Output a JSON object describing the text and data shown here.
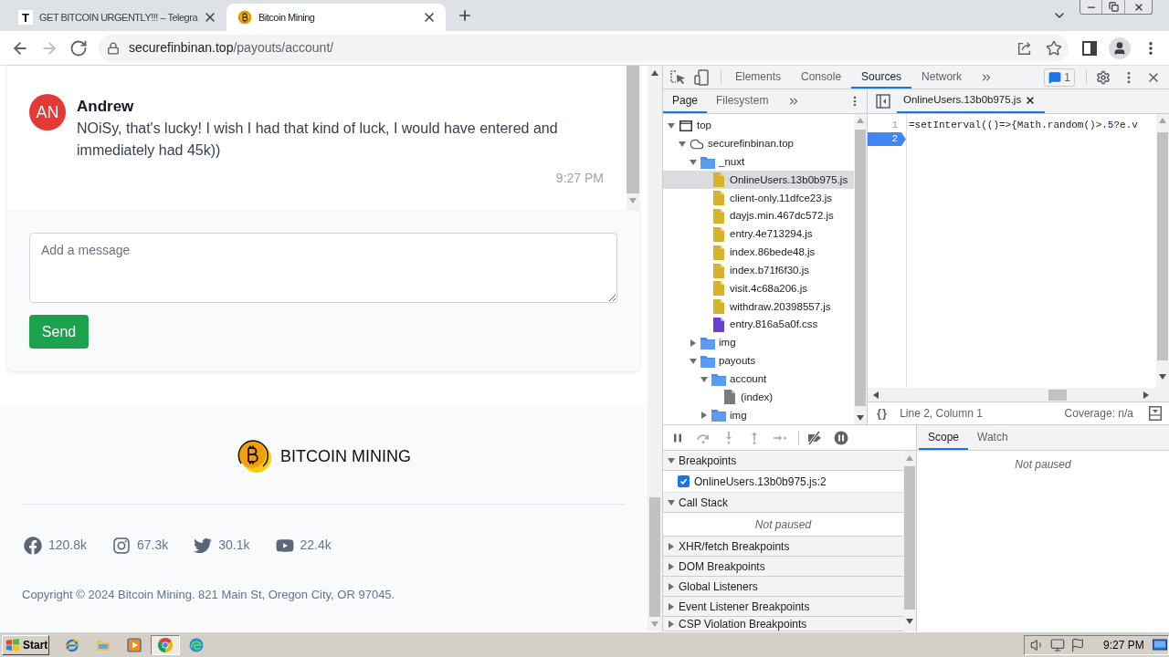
{
  "browser": {
    "tabs": [
      {
        "favicon": "T",
        "title": "GET BITCOIN URGENTLY!!! – Telegra",
        "selected": false
      },
      {
        "title": "Bitcoin Mining",
        "selected": true
      }
    ],
    "address": {
      "host": "securefinbinan.top",
      "path": "/payouts/account/"
    }
  },
  "page": {
    "messages": [
      {
        "initials": "AN",
        "author": "Andrew",
        "text": "NOiSy, that's lucky! I wish I had that kind of luck, I would have entered and immediately had 45k))",
        "time": "9:27 PM"
      }
    ],
    "composer": {
      "placeholder": "Add a message"
    },
    "send_button": "Send",
    "footer": {
      "brand": "BITCOIN MINING",
      "socials": [
        {
          "kind": "facebook",
          "count": "120.8k"
        },
        {
          "kind": "instagram",
          "count": "67.3k"
        },
        {
          "kind": "twitter",
          "count": "30.1k"
        },
        {
          "kind": "youtube",
          "count": "22.4k"
        }
      ],
      "copyright": "Copyright © 2024 Bitcoin Mining. 821 Main St, Oregon City, OR 97045."
    }
  },
  "devtools": {
    "tabs": [
      {
        "label": "Elements",
        "selected": false
      },
      {
        "label": "Console",
        "selected": false
      },
      {
        "label": "Sources",
        "selected": true
      },
      {
        "label": "Network",
        "selected": false
      }
    ],
    "issues_count": "1",
    "navigator": {
      "tabs": [
        {
          "label": "Page",
          "selected": true
        },
        {
          "label": "Filesystem",
          "selected": false
        }
      ],
      "tree": [
        {
          "label": "top",
          "kind": "frame",
          "expanded": true,
          "selected": false,
          "children": [
            {
              "label": "securefinbinan.top",
              "kind": "domain",
              "expanded": true,
              "selected": false,
              "children": [
                {
                  "label": "_nuxt",
                  "kind": "folder",
                  "expanded": true,
                  "selected": false,
                  "children": [
                    {
                      "label": "OnlineUsers.13b0b975.js",
                      "kind": "script",
                      "selected": true
                    },
                    {
                      "label": "client-only.11dfce23.js",
                      "kind": "script",
                      "selected": false
                    },
                    {
                      "label": "dayjs.min.467dc572.js",
                      "kind": "script",
                      "selected": false
                    },
                    {
                      "label": "entry.4e713294.js",
                      "kind": "script",
                      "selected": false
                    },
                    {
                      "label": "index.86bede48.js",
                      "kind": "script",
                      "selected": false
                    },
                    {
                      "label": "index.b71f6f30.js",
                      "kind": "script",
                      "selected": false
                    },
                    {
                      "label": "visit.4c68a206.js",
                      "kind": "script",
                      "selected": false
                    },
                    {
                      "label": "withdraw.20398557.js",
                      "kind": "script",
                      "selected": false
                    },
                    {
                      "label": "entry.816a5a0f.css",
                      "kind": "stylesheet",
                      "selected": false
                    }
                  ]
                },
                {
                  "label": "img",
                  "kind": "folder",
                  "expanded": false,
                  "selected": false
                },
                {
                  "label": "payouts",
                  "kind": "folder",
                  "expanded": true,
                  "selected": false,
                  "children": [
                    {
                      "label": "account",
                      "kind": "folder",
                      "expanded": true,
                      "selected": false,
                      "children": [
                        {
                          "label": "(index)",
                          "kind": "document",
                          "selected": false
                        }
                      ]
                    },
                    {
                      "label": "img",
                      "kind": "folder",
                      "expanded": false,
                      "selected": false
                    }
                  ]
                }
              ]
            }
          ]
        }
      ]
    },
    "editor": {
      "tab": {
        "label": "OnlineUsers.13b0b975.js",
        "selected": true
      },
      "lines": [
        {
          "number": "1",
          "breakpoint": false,
          "tokens": [
            {
              "kind": "plain",
              "text": "=setInterval(()=>{Math.random()>"
            },
            {
              "kind": "number",
              "text": ".5"
            },
            {
              "kind": "plain",
              "text": "?e.v"
            }
          ]
        },
        {
          "number": "2",
          "breakpoint": true
        }
      ],
      "format_button": "{}",
      "position": "Line 2, Column 1",
      "coverage": "Coverage: n/a"
    },
    "debugger": {
      "sections": [
        {
          "title": "Breakpoints",
          "expanded": true,
          "items": [
            {
              "label": "OnlineUsers.13b0b975.js:2",
              "checked": true
            }
          ]
        },
        {
          "title": "Call Stack",
          "expanded": true,
          "message": "Not paused"
        },
        {
          "title": "XHR/fetch Breakpoints",
          "expanded": false
        },
        {
          "title": "DOM Breakpoints",
          "expanded": false
        },
        {
          "title": "Global Listeners",
          "expanded": false
        },
        {
          "title": "Event Listener Breakpoints",
          "expanded": false
        },
        {
          "title": "CSP Violation Breakpoints",
          "expanded": false
        }
      ],
      "side_tabs": [
        {
          "label": "Scope",
          "selected": true
        },
        {
          "label": "Watch",
          "selected": false
        }
      ],
      "side_message": "Not paused"
    }
  },
  "taskbar": {
    "start": "Start",
    "apps": [
      {
        "kind": "ie",
        "active": false
      },
      {
        "kind": "folder",
        "active": false
      },
      {
        "kind": "media",
        "active": false
      },
      {
        "kind": "chrome",
        "active": true
      },
      {
        "kind": "edge",
        "active": false
      }
    ],
    "clock": "9:27 PM"
  }
}
